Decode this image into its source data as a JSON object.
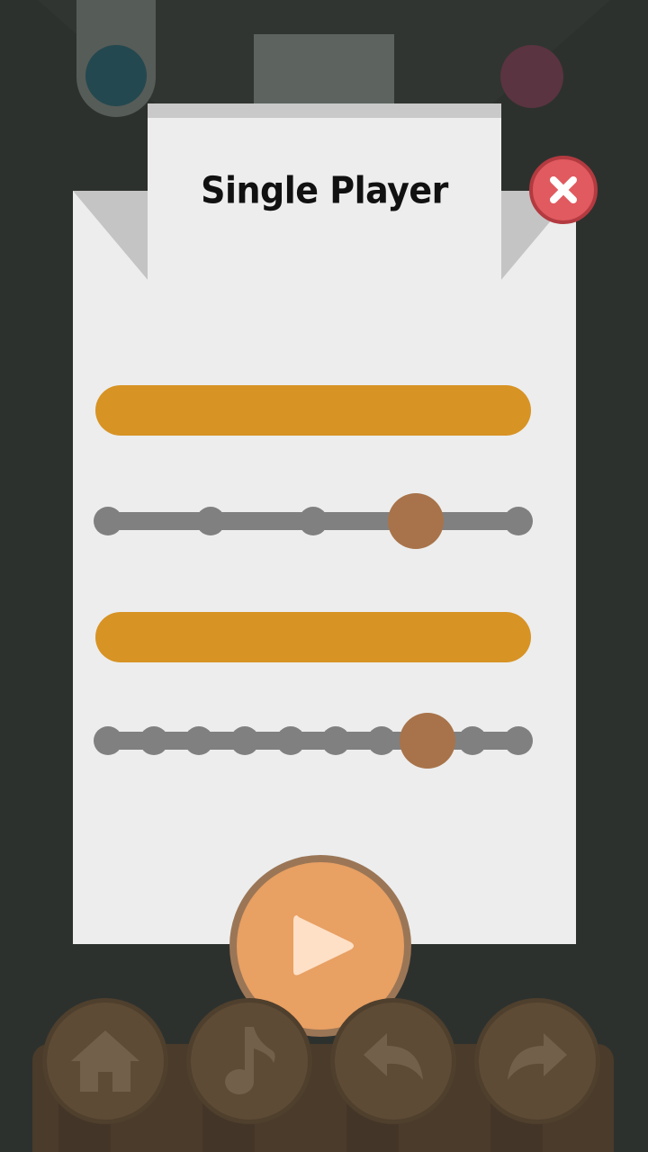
{
  "dialog": {
    "title": "Single Player"
  },
  "sliders": [
    {
      "steps": 5,
      "selected_index": 3
    },
    {
      "steps": 10,
      "selected_index": 7
    }
  ],
  "toolbar": {
    "icons": [
      "home-icon",
      "music-note-icon",
      "undo-icon",
      "redo-icon"
    ]
  },
  "colors": {
    "background": "#2d312e",
    "panel": "#ededed",
    "accent_bar": "#d79324",
    "slider_track": "#808080",
    "slider_knob": "#a8734a",
    "play_button": "#e8a063",
    "close_button": "#e05a5f",
    "toolbar": "#5e4b35"
  }
}
